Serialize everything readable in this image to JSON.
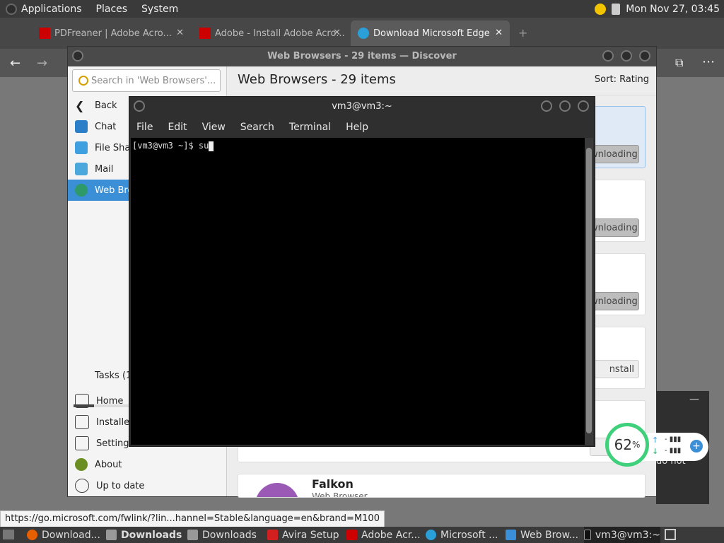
{
  "top_panel": {
    "menus": [
      "Applications",
      "Places",
      "System"
    ],
    "clock": "Mon Nov 27, 03:45"
  },
  "browser": {
    "tabs": [
      {
        "label": "PDFreaner | Adobe Acro..."
      },
      {
        "label": "Adobe - Install Adobe Acro..."
      },
      {
        "label": "Download Microsoft Edge"
      }
    ],
    "active_tab_index": 2
  },
  "discover": {
    "title": "Web Browsers - 29 items — Discover",
    "search_placeholder": "Search in 'Web Browsers'...",
    "heading": "Web Browsers - 29 items",
    "sort": "Sort: Rating",
    "sidebar_top": [
      {
        "label": "Back",
        "icon": "back-arrow-icon"
      },
      {
        "label": "Chat",
        "icon": "chat-icon"
      },
      {
        "label": "File Shar",
        "icon": "file-sharing-icon"
      },
      {
        "label": "Mail",
        "icon": "mail-icon"
      },
      {
        "label": "Web Bro",
        "icon": "globe-icon",
        "selected": true
      }
    ],
    "tasks_label": "Tasks (12",
    "tasks_progress": 0.14,
    "sidebar_bottom": [
      {
        "label": "Home",
        "icon": "home-icon"
      },
      {
        "label": "Installed",
        "icon": "installed-icon"
      },
      {
        "label": "Settings",
        "icon": "settings-icon"
      },
      {
        "label": "About",
        "icon": "about-icon"
      },
      {
        "label": "Up to date",
        "icon": "update-icon"
      }
    ],
    "cards": [
      {
        "button": "wnloading"
      },
      {
        "button": "wnloading"
      },
      {
        "button": "wnloading"
      },
      {
        "button": "nstall"
      },
      {
        "button": "Ins"
      }
    ],
    "falkon": {
      "name": "Falkon",
      "subtitle": "Web Browser"
    }
  },
  "terminal": {
    "title": "vm3@vm3:~",
    "menu": [
      "File",
      "Edit",
      "View",
      "Search",
      "Terminal",
      "Help"
    ],
    "prompt": "[vm3@vm3 ~]$ su"
  },
  "netmeter": {
    "percent": "62",
    "unit": "%",
    "popup_text": "do not"
  },
  "status_url": "https://go.microsoft.com/fwlink/?lin...hannel=Stable&language=en&brand=M100",
  "taskbar": [
    {
      "label": "Download...",
      "icon": "firefox-icon"
    },
    {
      "label": "Downloads",
      "icon": "folder-icon",
      "bold": true
    },
    {
      "label": "Downloads",
      "icon": "folder-icon"
    },
    {
      "label": "Avira Setup",
      "icon": "avira-icon"
    },
    {
      "label": "Adobe Acr...",
      "icon": "adobe-icon"
    },
    {
      "label": "Microsoft ...",
      "icon": "edge-icon"
    },
    {
      "label": "Web Brow...",
      "icon": "discover-icon"
    },
    {
      "label": "vm3@vm3:~",
      "icon": "terminal-icon"
    }
  ],
  "colors": {
    "accent": "#3a8fd6",
    "meter_ring": "#3ed07a"
  }
}
